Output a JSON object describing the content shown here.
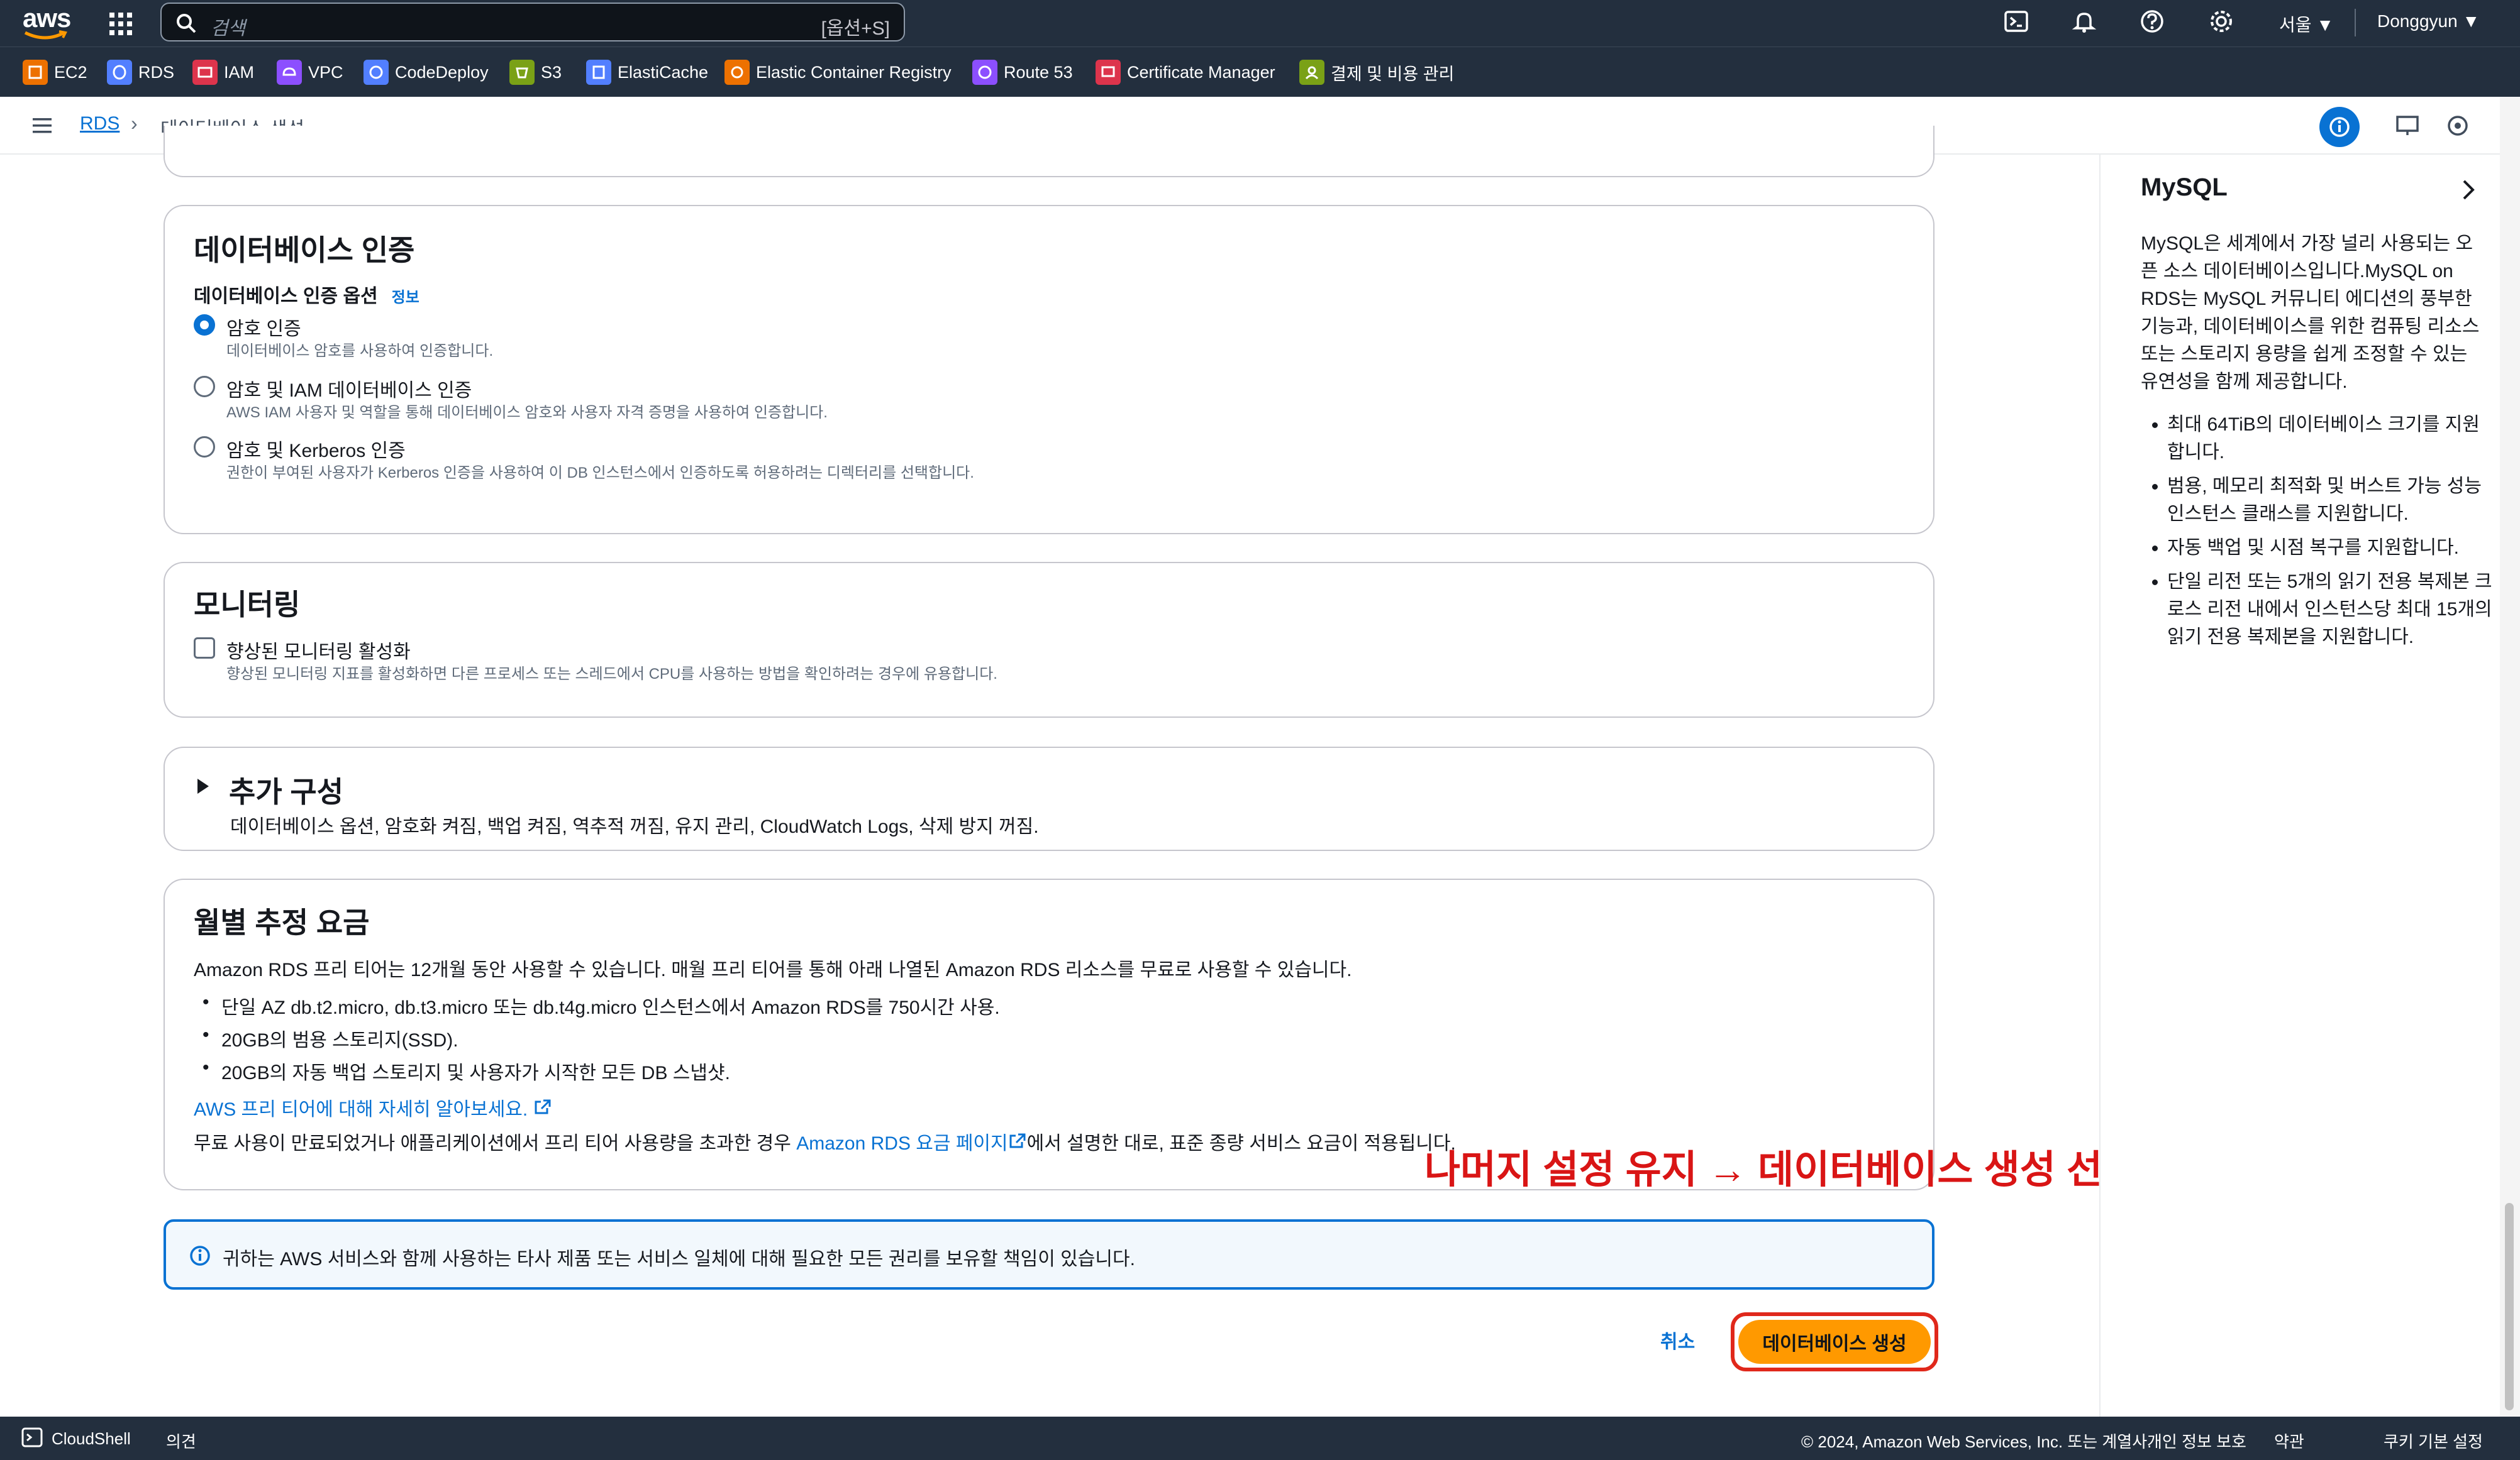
{
  "topbar": {
    "logo": "aws",
    "search_placeholder": "검색",
    "search_shortcut": "[옵션+S]",
    "region": "서울 ▼",
    "user": "Donggyun ▼"
  },
  "favorites": [
    {
      "label": "EC2",
      "color": "#ed7100"
    },
    {
      "label": "RDS",
      "color": "#527fff"
    },
    {
      "label": "IAM",
      "color": "#dd344c"
    },
    {
      "label": "VPC",
      "color": "#8c4fff"
    },
    {
      "label": "CodeDeploy",
      "color": "#527fff"
    },
    {
      "label": "S3",
      "color": "#7aa116"
    },
    {
      "label": "ElastiCache",
      "color": "#527fff"
    },
    {
      "label": "Elastic Container Registry",
      "color": "#ed7100"
    },
    {
      "label": "Route 53",
      "color": "#8c4fff"
    },
    {
      "label": "Certificate Manager",
      "color": "#dd344c"
    },
    {
      "label": "결제 및 비용 관리",
      "color": "#7aa116"
    }
  ],
  "breadcrumb": {
    "root": "RDS",
    "current": "데이터베이스 생성"
  },
  "auth": {
    "title": "데이터베이스 인증",
    "options_label": "데이터베이스 인증 옵션",
    "info": "정보",
    "options": [
      {
        "title": "암호 인증",
        "desc": "데이터베이스 암호를 사용하여 인증합니다.",
        "selected": true
      },
      {
        "title": "암호 및 IAM 데이터베이스 인증",
        "desc": "AWS IAM 사용자 및 역할을 통해 데이터베이스 암호와 사용자 자격 증명을 사용하여 인증합니다.",
        "selected": false
      },
      {
        "title": "암호 및 Kerberos 인증",
        "desc": "권한이 부여된 사용자가 Kerberos 인증을 사용하여 이 DB 인스턴스에서 인증하도록 허용하려는 디렉터리를 선택합니다.",
        "selected": false
      }
    ]
  },
  "monitoring": {
    "title": "모니터링",
    "checkbox_label": "향상된 모니터링 활성화",
    "checkbox_desc": "향상된 모니터링 지표를 활성화하면 다른 프로세스 또는 스레드에서 CPU를 사용하는 방법을 확인하려는 경우에 유용합니다."
  },
  "additional": {
    "title": "추가 구성",
    "desc": "데이터베이스 옵션, 암호화 켜짐, 백업 켜짐, 역추적 꺼짐, 유지 관리, CloudWatch Logs, 삭제 방지 꺼짐."
  },
  "cost": {
    "title": "월별 추정 요금",
    "intro": "Amazon RDS 프리 티어는 12개월 동안 사용할 수 있습니다. 매월 프리 티어를 통해 아래 나열된 Amazon RDS 리소스를 무료로 사용할 수 있습니다.",
    "bullets": [
      "단일 AZ db.t2.micro, db.t3.micro 또는 db.t4g.micro 인스턴스에서 Amazon RDS를 750시간 사용.",
      "20GB의 범용 스토리지(SSD).",
      "20GB의 자동 백업 스토리지 및 사용자가 시작한 모든 DB 스냅샷."
    ],
    "learn_more": "AWS 프리 티어에 대해 자세히 알아보세요.",
    "note_prefix": "무료 사용이 만료되었거나 애플리케이션에서 프리 티어 사용량을 초과한 경우 ",
    "note_link": "Amazon RDS 요금 페이지",
    "note_suffix": "에서 설명한 대로, 표준 종량 서비스 요금이 적용됩니다."
  },
  "annotation": "나머지 설정 유지 → 데이터베이스 생성 선택",
  "alert": "귀하는 AWS 서비스와 함께 사용하는 타사 제품 또는 서비스 일체에 대해 필요한 모든 권리를 보유할 책임이 있습니다.",
  "actions": {
    "cancel": "취소",
    "create": "데이터베이스 생성"
  },
  "help": {
    "title": "MySQL",
    "para": "MySQL은 세계에서 가장 널리 사용되는 오픈 소스 데이터베이스입니다.MySQL on RDS는 MySQL 커뮤니티 에디션의 풍부한 기능과, 데이터베이스를 위한 컴퓨팅 리소스 또는 스토리지 용량을 쉽게 조정할 수 있는 유연성을 함께 제공합니다.",
    "bullets": [
      "최대 64TiB의 데이터베이스 크기를 지원합니다.",
      "범용, 메모리 최적화 및 버스트 가능 성능 인스턴스 클래스를 지원합니다.",
      "자동 백업 및 시점 복구를 지원합니다.",
      "단일 리전 또는 5개의 읽기 전용 복제본 크로스 리전 내에서 인스턴스당 최대 15개의 읽기 전용 복제본을 지원합니다."
    ]
  },
  "footer": {
    "cloudshell": "CloudShell",
    "feedback": "의견",
    "copyright": "© 2024, Amazon Web Services, Inc. 또는 계열사.",
    "privacy": "개인 정보 보호",
    "terms": "약관",
    "cookies": "쿠키 기본 설정"
  }
}
